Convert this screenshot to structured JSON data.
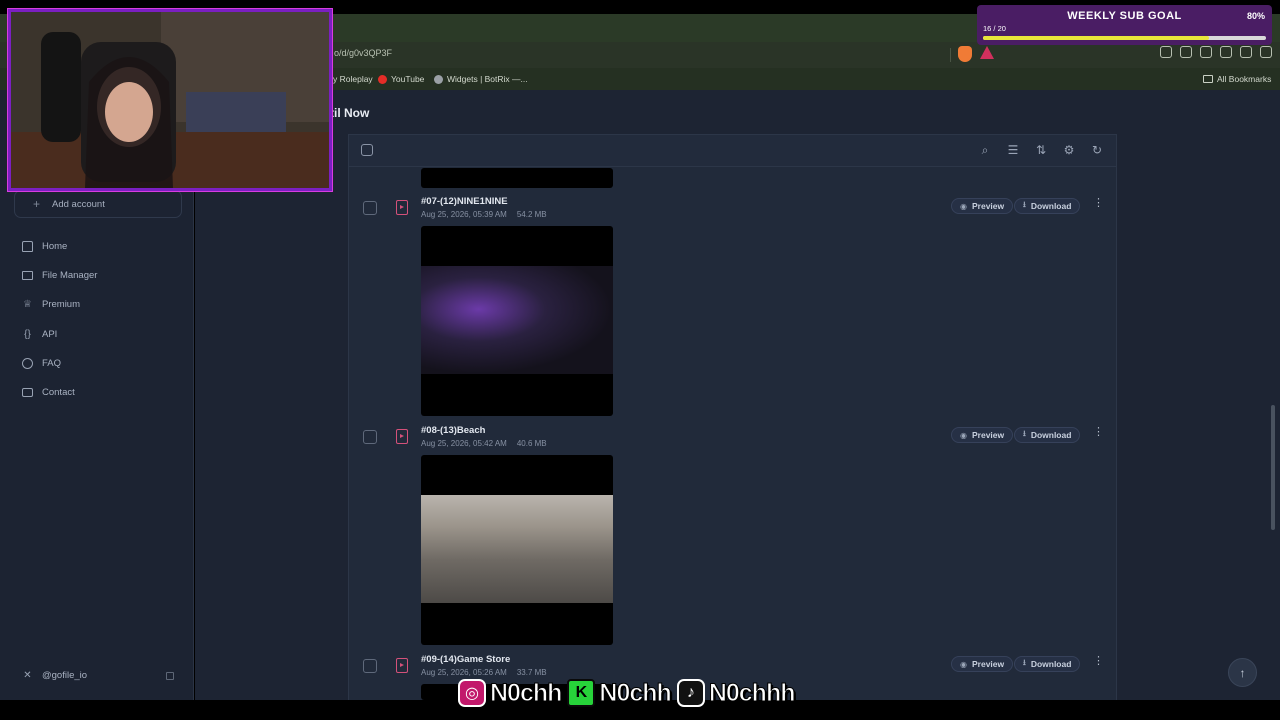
{
  "browser": {
    "url": "o/d/g0v3QP3F",
    "bookmarks": [
      {
        "label": "y Roleplay",
        "icon": "roleplay-icon"
      },
      {
        "label": "YouTube",
        "icon": "youtube-icon",
        "color": "#e52d27"
      },
      {
        "label": "Widgets | BotRix —...",
        "icon": "botrix-icon"
      }
    ],
    "all_bookmarks_label": "All Bookmarks"
  },
  "page": {
    "title": "til Now"
  },
  "sidebar": {
    "add_account_label": "Add account",
    "items": [
      {
        "label": "Home",
        "icon": "home-icon"
      },
      {
        "label": "File Manager",
        "icon": "folder-icon"
      },
      {
        "label": "Premium",
        "icon": "crown-icon"
      },
      {
        "label": "API",
        "icon": "braces-icon"
      },
      {
        "label": "FAQ",
        "icon": "question-icon"
      },
      {
        "label": "Contact",
        "icon": "mail-icon"
      }
    ],
    "social_label": "@gofile_io"
  },
  "files": [
    {
      "name": "#07-(12)NINE1NINE",
      "date": "Aug 25, 2026, 05:39 AM",
      "size": "54.2 MB"
    },
    {
      "name": "#08-(13)Beach",
      "date": "Aug 25, 2026, 05:42 AM",
      "size": "40.6 MB"
    },
    {
      "name": "#09-(14)Game Store",
      "date": "Aug 25, 2026, 05:26 AM",
      "size": "33.7 MB"
    }
  ],
  "actions": {
    "preview_label": "Preview",
    "download_label": "Download"
  },
  "overlay": {
    "sub_goal_title": "WEEKLY SUB GOAL",
    "sub_goal_percent": "80%",
    "sub_goal_count": "16 / 20",
    "sub_goal_progress": 0.8,
    "handles": [
      {
        "platform": "instagram",
        "name": "N0chh"
      },
      {
        "platform": "kick",
        "name": "N0chh"
      },
      {
        "platform": "tiktok",
        "name": "N0chhh"
      }
    ]
  },
  "colors": {
    "accent_pink": "#d4517a",
    "goal_bar": "#e8e63a",
    "goal_bg": "#4a1d64",
    "webcam_border": "#7b1fc2"
  }
}
